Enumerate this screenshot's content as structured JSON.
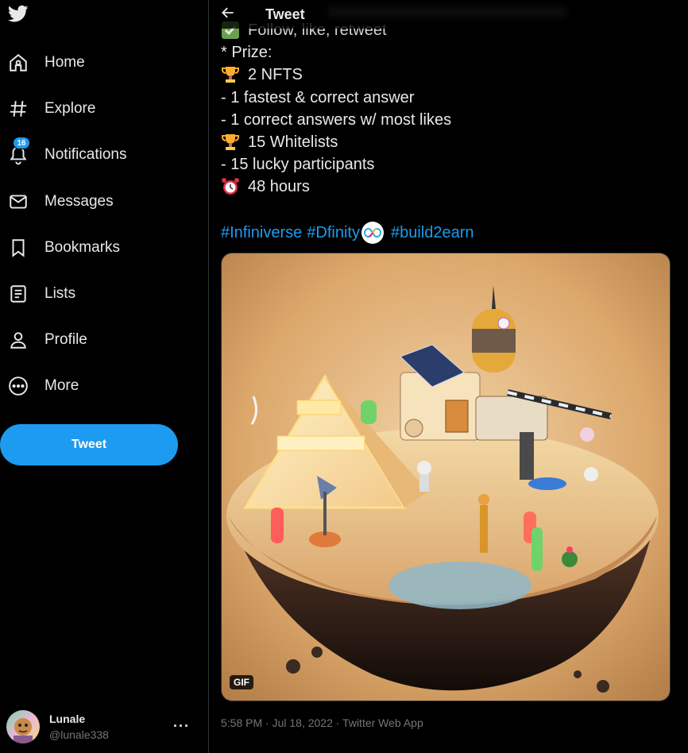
{
  "sidebar": {
    "logo": "twitter-bird-icon",
    "items": [
      {
        "label": "Home",
        "icon": "home-icon"
      },
      {
        "label": "Explore",
        "icon": "hashtag-icon"
      },
      {
        "label": "Notifications",
        "icon": "bell-icon",
        "badge": "16"
      },
      {
        "label": "Messages",
        "icon": "envelope-icon"
      },
      {
        "label": "Bookmarks",
        "icon": "bookmark-icon"
      },
      {
        "label": "Lists",
        "icon": "list-icon"
      },
      {
        "label": "Profile",
        "icon": "person-icon"
      },
      {
        "label": "More",
        "icon": "more-circle-icon"
      }
    ],
    "tweet_button": "Tweet",
    "account": {
      "name": "Lunale",
      "handle": "@lunale338",
      "more": "···"
    }
  },
  "header": {
    "title": "Tweet"
  },
  "tweet": {
    "lines": [
      "Follow, like, retweet",
      "* Prize:",
      "2 NFTS",
      "- 1 fastest & correct answer",
      "- 1 correct answers w/ most likes",
      "15 Whitelists",
      "- 15 lucky participants",
      "48 hours"
    ],
    "hashtags": [
      "#Infiniverse",
      "#Dfinity",
      "#build2earn"
    ],
    "media_badge": "GIF",
    "timestamp": "5:58 PM · Jul 18, 2022 · Twitter Web App"
  },
  "colors": {
    "accent": "#1d9bf0",
    "background": "#000000",
    "text": "#e7e9ea",
    "muted": "#71767b"
  }
}
